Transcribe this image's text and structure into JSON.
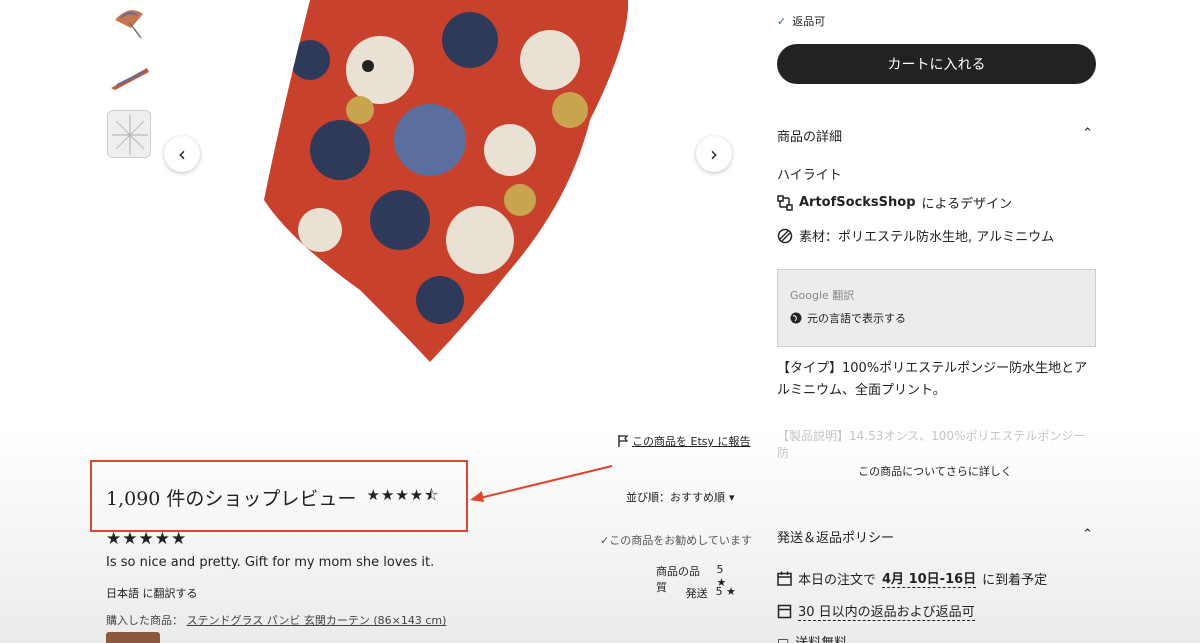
{
  "gallery": {
    "prev_symbol": "‹",
    "next_symbol": "›"
  },
  "report": {
    "label": "この商品を Etsy に報告"
  },
  "reviews": {
    "title": "1,090 件のショップレビュー",
    "shop_rating_stars": "★★★★⯪",
    "sort_label": "並び順：おすすめ順",
    "sort_caret": "▾",
    "review_stars": "★★★★★",
    "recommend": "✓この商品をお勧めしています",
    "text": "Is so nice and pretty. Gift for my mom she loves it.",
    "translate": "日本語 に翻訳する",
    "ratings": [
      {
        "label": "商品の品質",
        "value": "5 ★"
      },
      {
        "label": "発送",
        "value": "5 ★"
      }
    ],
    "purchased_label": "購入した商品：",
    "purchased_item": "ステンドグラス パンビ 玄関カーテン (86×143 cm)"
  },
  "buy": {
    "returns": "返品可",
    "add_to_cart": "カートに入れる"
  },
  "details": {
    "heading": "商品の詳細",
    "highlights": "ハイライト",
    "design_shop": "ArtofSocksShop",
    "design_suffix": "によるデザイン",
    "material": "素材：ポリエステル防水生地, アルミニウム",
    "google_translate": "Google 翻訳",
    "show_original": "元の言語で表示する",
    "description": "【タイプ】100%ポリエステルポンジー防水生地とアルミニウム、全面プリント。",
    "description_faded": "【製品説明】14.53オンス、100%ポリエステルポンジー防",
    "learn_more": "この商品についてさらに詳しく"
  },
  "policy": {
    "heading": "発送＆返品ポリシー",
    "delivery_prefix": "本日の注文で",
    "delivery_dates": "4月 10日-16日",
    "delivery_suffix": "に到着予定",
    "returns": "30 日以内の返品および返品可",
    "free_shipping": "送料無料"
  },
  "colors": {
    "highlight_box": "#e0442c",
    "cart_button": "#222222"
  }
}
